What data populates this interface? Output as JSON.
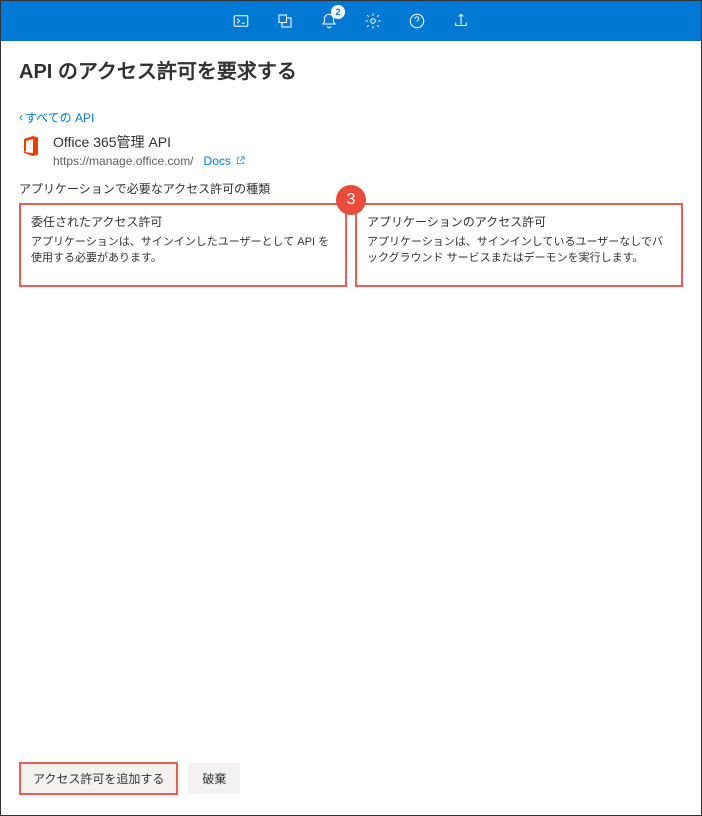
{
  "topbar": {
    "notification_count": "2"
  },
  "page": {
    "title": "API のアクセス許可を要求する",
    "back_link": "すべての API"
  },
  "api": {
    "name": "Office 365管理 API",
    "url": "https://manage.office.com/",
    "docs_label": "Docs"
  },
  "permission_type_label": "アプリケーションで必要なアクセス許可の種類",
  "cards": {
    "delegated": {
      "title": "委任されたアクセス許可",
      "desc": "アプリケーションは、サインインしたユーザーとして API を使用する必要があります。"
    },
    "application": {
      "title": "アプリケーションのアクセス許可",
      "desc": "アプリケーションは、サインインしているユーザーなしでバックグラウンド サービスまたはデーモンを実行します。"
    }
  },
  "step_number": "3",
  "footer": {
    "add_button": "アクセス許可を追加する",
    "discard_button": "破棄"
  }
}
